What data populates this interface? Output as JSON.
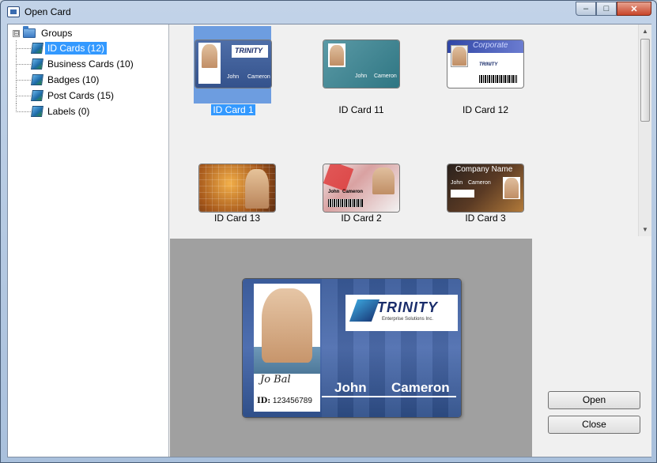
{
  "window": {
    "title": "Open Card",
    "minimize": "–",
    "maximize": "□",
    "close": "✕"
  },
  "tree": {
    "root": "Groups",
    "root_expander": "⊟",
    "items": [
      {
        "label": "ID Cards (12)",
        "selected": true
      },
      {
        "label": "Business Cards (10)",
        "selected": false
      },
      {
        "label": "Badges (10)",
        "selected": false
      },
      {
        "label": "Post Cards (15)",
        "selected": false
      },
      {
        "label": "Labels (0)",
        "selected": false
      }
    ]
  },
  "thumbnails": [
    {
      "caption": "ID Card 1",
      "selected": true,
      "first": "John",
      "last": "Cameron",
      "brand": "TRINITY"
    },
    {
      "caption": "ID Card 11",
      "selected": false,
      "first": "John",
      "last": "Cameron"
    },
    {
      "caption": "ID Card 12",
      "selected": false,
      "brand": "Corporate",
      "brand2": "TRINITY"
    },
    {
      "caption": "ID Card 13",
      "selected": false
    },
    {
      "caption": "ID Card 2",
      "selected": false,
      "first": "John",
      "last": "Cameron"
    },
    {
      "caption": "ID Card 3",
      "selected": false,
      "brand": "Company Name",
      "first": "John",
      "last": "Cameron"
    }
  ],
  "preview": {
    "brand": "TRINITY",
    "brand_sub": "Enterprise Solutions Inc.",
    "first_name": "John",
    "last_name": "Cameron",
    "signature": "Jo Bal",
    "id_label": "ID:",
    "id_value": "123456789"
  },
  "buttons": {
    "open": "Open",
    "close": "Close"
  },
  "icons": {
    "app": "card-window-icon",
    "folder": "folder-icon",
    "group_item": "card-stack-icon"
  }
}
